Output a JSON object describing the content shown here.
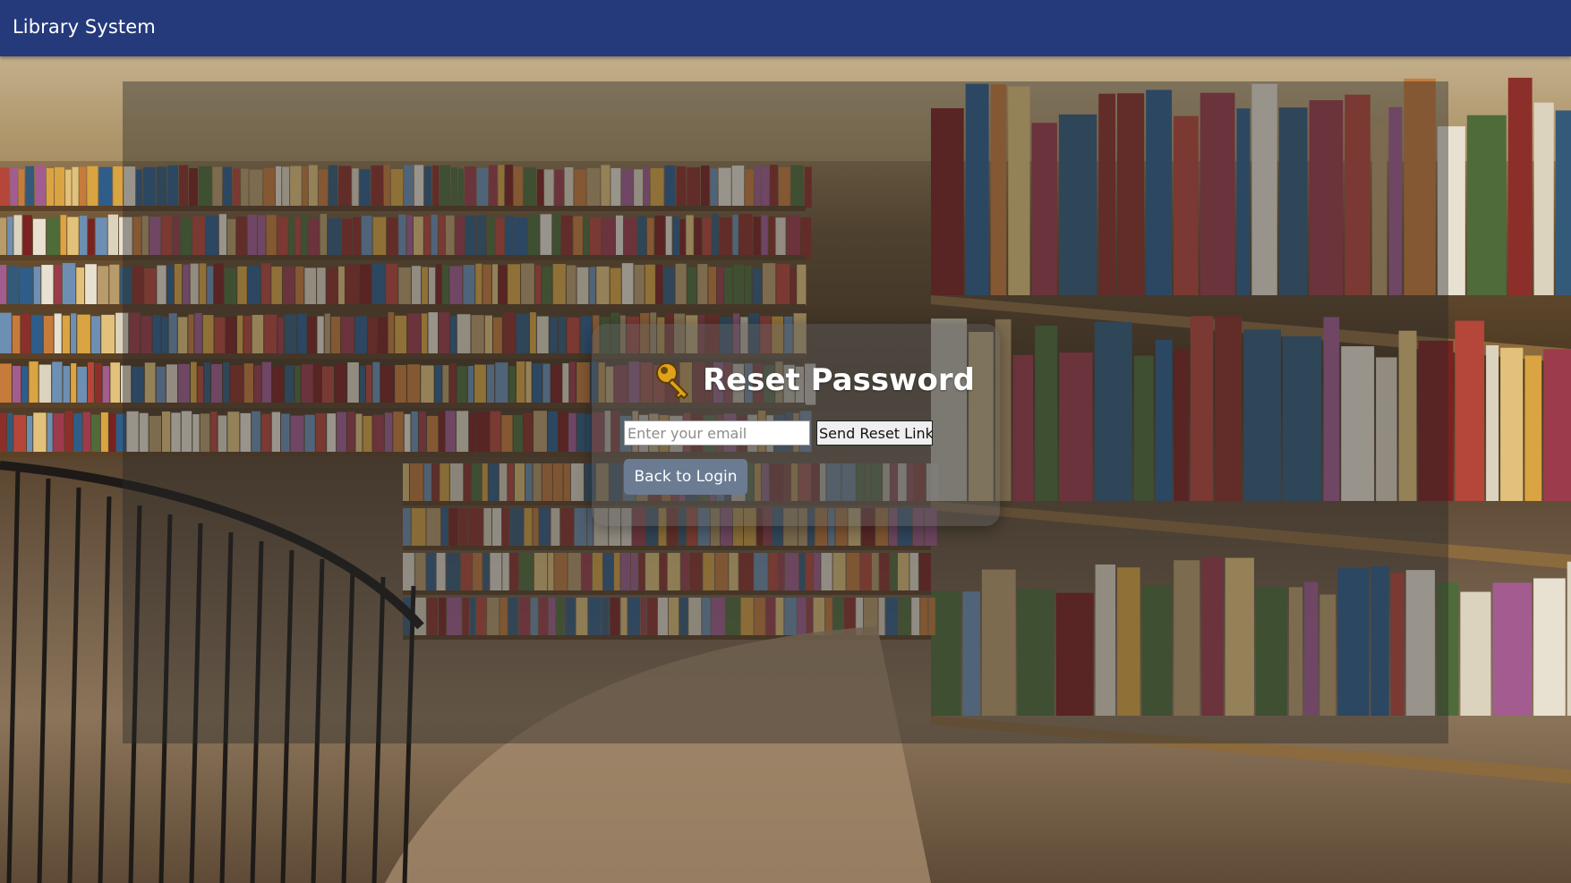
{
  "app": {
    "title": "Library System"
  },
  "reset_card": {
    "icon": "key-icon",
    "title": "Reset Password",
    "email_placeholder": "Enter your email",
    "email_value": "",
    "send_button_label": "Send Reset Link",
    "back_button_label": "Back to Login"
  },
  "colors": {
    "topbar": "#253a7b",
    "back_button": "#6b7b92",
    "key_gold": "#e0a21c"
  }
}
